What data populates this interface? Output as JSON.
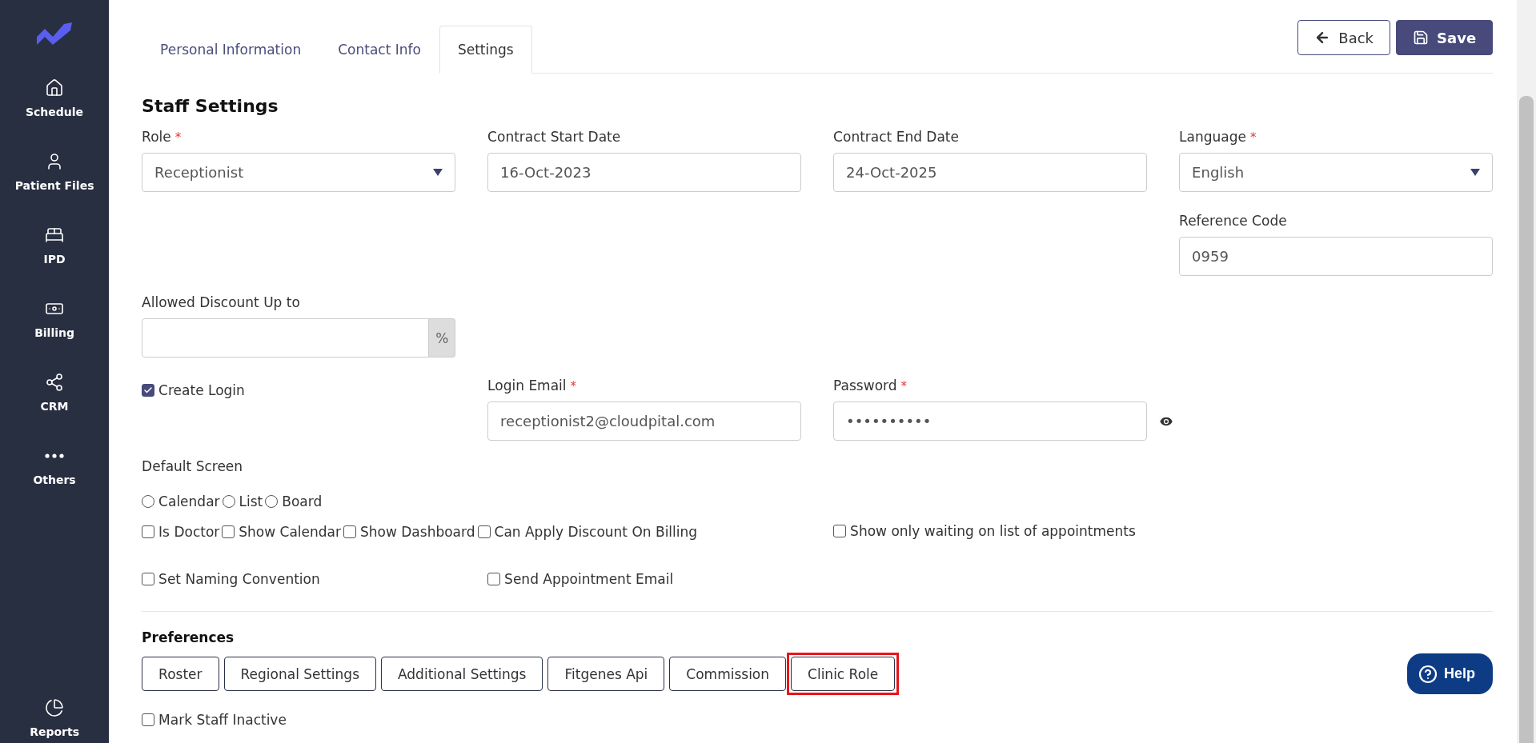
{
  "sidebar": {
    "items": [
      {
        "label": "Schedule"
      },
      {
        "label": "Patient Files"
      },
      {
        "label": "IPD"
      },
      {
        "label": "Billing"
      },
      {
        "label": "CRM"
      },
      {
        "label": "Others"
      }
    ],
    "footer": {
      "label": "Reports"
    }
  },
  "tabs": [
    {
      "label": "Personal Information",
      "selected": false
    },
    {
      "label": "Contact Info",
      "selected": false
    },
    {
      "label": "Settings",
      "selected": true
    }
  ],
  "actions": {
    "back": "Back",
    "save": "Save"
  },
  "section_title": "Staff Settings",
  "required_mark": "*",
  "role": {
    "label": "Role",
    "required": true,
    "value": "Receptionist"
  },
  "contract_start": {
    "label": "Contract Start Date",
    "required": false,
    "value": "16-Oct-2023"
  },
  "contract_end": {
    "label": "Contract End Date",
    "required": false,
    "value": "24-Oct-2025"
  },
  "language": {
    "label": "Language",
    "required": true,
    "value": "English"
  },
  "reference_code": {
    "label": "Reference Code",
    "required": false,
    "value": "0959"
  },
  "allowed_discount": {
    "label": "Allowed Discount Up to",
    "required": false,
    "addon": "%"
  },
  "create_login": {
    "label": "Create Login",
    "checked": true
  },
  "login_email": {
    "label": "Login Email",
    "required": true,
    "value": "receptionist2@cloudpital.com"
  },
  "password": {
    "label": "Password",
    "required": true,
    "value": "••••••••••"
  },
  "default_screen": {
    "label": "Default Screen",
    "options": [
      {
        "label": "Calendar",
        "selected": false
      },
      {
        "label": "List",
        "selected": false
      },
      {
        "label": "Board",
        "selected": false
      }
    ]
  },
  "checkboxes": [
    {
      "label": "Is Doctor",
      "checked": false
    },
    {
      "label": "Show Calendar",
      "checked": false
    },
    {
      "label": "Show Dashboard",
      "checked": false
    },
    {
      "label": "Can Apply Discount On Billing",
      "checked": false
    },
    {
      "label": "Show only waiting on list of appointments",
      "checked": false
    },
    {
      "label": "Set Naming Convention",
      "checked": false
    },
    {
      "label": "Send Appointment Email",
      "checked": false
    }
  ],
  "preferences": {
    "title": "Preferences",
    "buttons": [
      {
        "label": "Roster",
        "highlighted": false
      },
      {
        "label": "Regional Settings",
        "highlighted": false
      },
      {
        "label": "Additional Settings",
        "highlighted": false
      },
      {
        "label": "Fitgenes Api",
        "highlighted": false
      },
      {
        "label": "Commission",
        "highlighted": false
      },
      {
        "label": "Clinic Role",
        "highlighted": true
      }
    ]
  },
  "mark_inactive": {
    "label": "Mark Staff Inactive",
    "checked": false
  },
  "help": {
    "label": "Help"
  }
}
